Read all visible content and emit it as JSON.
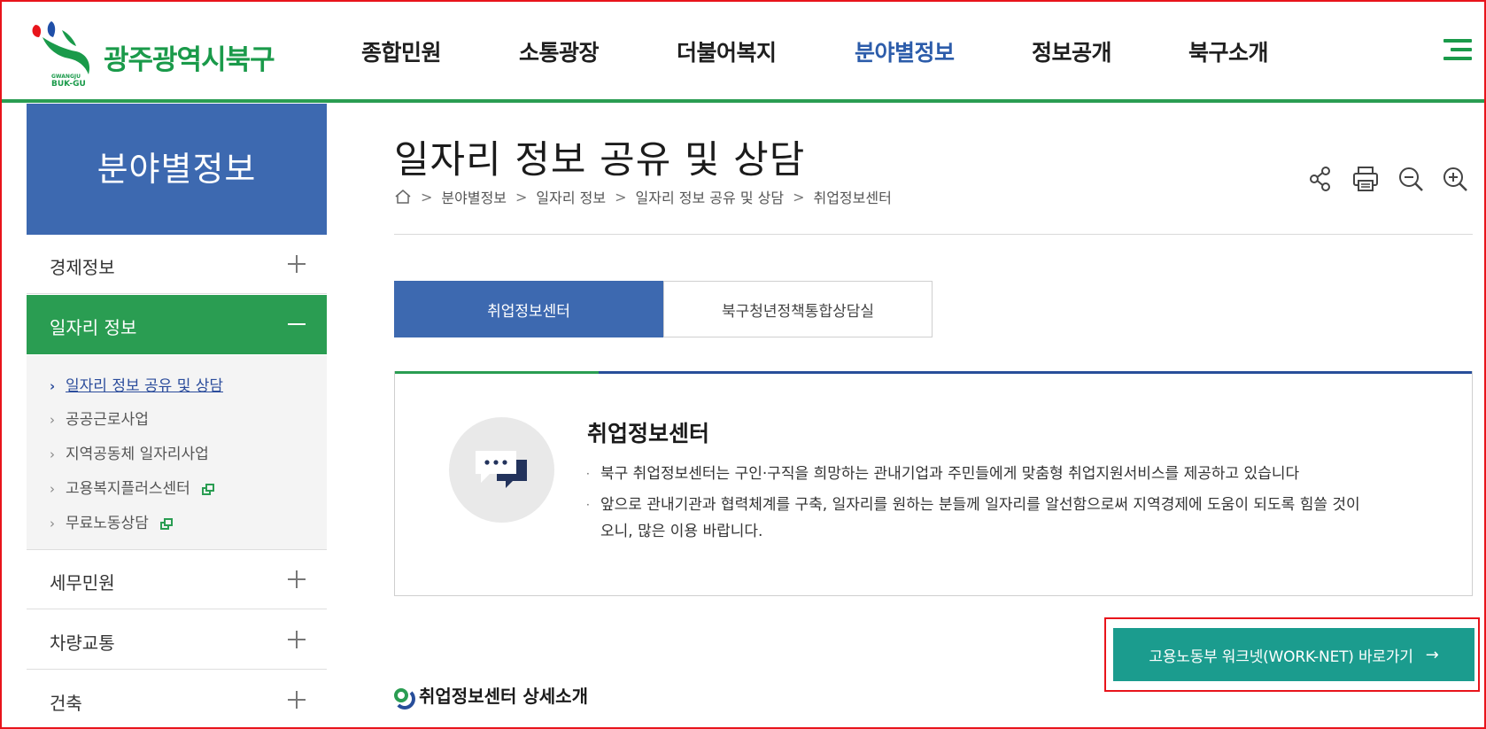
{
  "header": {
    "logo_text": "광주광역시북구",
    "logo_en_top": "GWANGJU",
    "logo_en_bottom": "BUK-GU",
    "nav": [
      {
        "label": "종합민원"
      },
      {
        "label": "소통광장"
      },
      {
        "label": "더불어복지"
      },
      {
        "label": "분야별정보",
        "active": true
      },
      {
        "label": "정보공개"
      },
      {
        "label": "북구소개"
      }
    ],
    "menu_icon": "hamburger-menu-icon"
  },
  "sidebar": {
    "title": "분야별정보",
    "items": [
      {
        "label": "경제정보",
        "expanded": false
      },
      {
        "label": "일자리 정보",
        "expanded": true
      },
      {
        "label": "세무민원",
        "expanded": false
      },
      {
        "label": "차량교통",
        "expanded": false
      },
      {
        "label": "건축",
        "expanded": false
      }
    ],
    "sub_items": [
      {
        "label": "일자리 정보 공유 및 상담",
        "active": true,
        "new_window": false
      },
      {
        "label": "공공근로사업",
        "active": false,
        "new_window": false
      },
      {
        "label": "지역공동체 일자리사업",
        "active": false,
        "new_window": false
      },
      {
        "label": "고용복지플러스센터",
        "active": false,
        "new_window": true
      },
      {
        "label": "무료노동상담",
        "active": false,
        "new_window": true
      }
    ]
  },
  "main": {
    "title": "일자리 정보 공유 및 상담",
    "breadcrumb": [
      "분야별정보",
      "일자리 정보",
      "일자리 정보 공유 및 상담",
      "취업정보센터"
    ],
    "tools": [
      "share-icon",
      "print-icon",
      "zoom-out-icon",
      "zoom-in-icon"
    ],
    "tabs": [
      {
        "label": "취업정보센터",
        "active": true
      },
      {
        "label": "북구청년정책통합상담실",
        "active": false
      }
    ],
    "info": {
      "title": "취업정보센터",
      "bullets": [
        "북구 취업정보센터는 구인·구직을 희망하는 관내기업과 주민들에게 맞춤형 취업지원서비스를 제공하고 있습니다",
        "앞으로 관내기관과 협력체계를 구축, 일자리를 원하는 분들께 일자리를 알선함으로써 지역경제에 도움이 되도록 힘쓸 것이오니, 많은 이용 바랍니다."
      ]
    },
    "worknet_button": "고용노동부 워크넷(WORK-NET) 바로가기",
    "worknet_arrow": "→",
    "section_heading": "취업정보센터 상세소개"
  },
  "colors": {
    "brand_green": "#2a9d52",
    "brand_blue": "#3d69b0",
    "teal_button": "#1b9c8e",
    "highlight_red": "#e8141b"
  }
}
